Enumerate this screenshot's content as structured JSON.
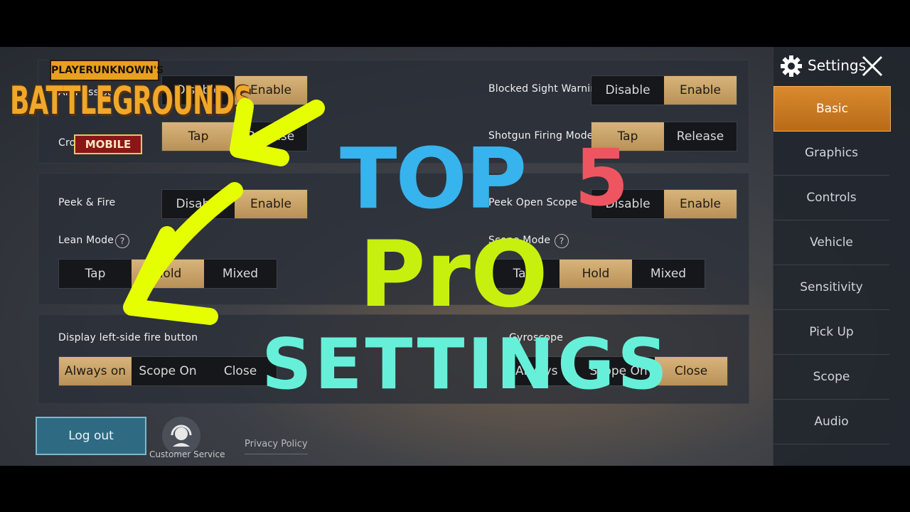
{
  "colors": {
    "gold": "#c9a468",
    "active_tab": "#c97a22",
    "overlay_top": "#37b3ee",
    "overlay_five": "#ef5560",
    "overlay_pro": "#c8f00f",
    "overlay_settings": "#67f0d9",
    "arrow": "#e6ff00"
  },
  "logo": {
    "line1": "PLAYERUNKNOWN'S",
    "line2": "BATTLEGROUNDS",
    "line3": "MOBILE"
  },
  "overlay": {
    "top": "TOP",
    "five": "5",
    "pro": "PrO",
    "settings": "SETTINGS"
  },
  "panel1": {
    "left_row1": {
      "label": "Aim Assist",
      "options": [
        "Disable",
        "Enable"
      ],
      "selected": 1
    },
    "left_row2": {
      "label": "Crosshair Mode",
      "options": [
        "Tap",
        "Release"
      ],
      "selected": 0
    },
    "right_row1": {
      "label": "Blocked Sight Warning",
      "options": [
        "Disable",
        "Enable"
      ],
      "selected": 1
    },
    "right_row2": {
      "label": "Shotgun Firing Mode",
      "options": [
        "Tap",
        "Release"
      ],
      "selected": 0
    }
  },
  "panel2": {
    "left_row1": {
      "label": "Peek & Fire",
      "options": [
        "Disable",
        "Enable"
      ],
      "selected": 1
    },
    "left_row2": {
      "label": "Lean Mode",
      "help": "?",
      "options": [
        "Tap",
        "Hold",
        "Mixed"
      ],
      "selected": 1
    },
    "right_row1": {
      "label": "Peek Open Scope",
      "options": [
        "Disable",
        "Enable"
      ],
      "selected": 1
    },
    "right_row2": {
      "label": "Scope Mode",
      "help": "?",
      "options": [
        "Tap",
        "Hold",
        "Mixed"
      ],
      "selected": 1
    }
  },
  "panel3": {
    "left": {
      "label": "Display left-side fire button",
      "options": [
        "Always on",
        "Scope On",
        "Close"
      ],
      "selected": 0
    },
    "right": {
      "label": "Gyroscope",
      "options": [
        "Always on",
        "Scope On",
        "Close"
      ],
      "selected": 2
    }
  },
  "footer": {
    "logout": "Log out",
    "customer_service": "Customer Service",
    "privacy": "Privacy Policy"
  },
  "sidebar": {
    "title": "Settings",
    "items": [
      "Basic",
      "Graphics",
      "Controls",
      "Vehicle",
      "Sensitivity",
      "Pick Up",
      "Scope",
      "Audio"
    ],
    "active": 0
  }
}
